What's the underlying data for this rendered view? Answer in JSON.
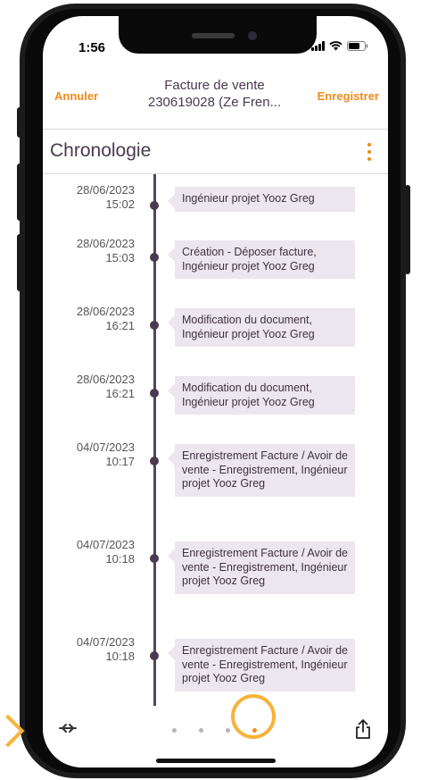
{
  "status_bar": {
    "time": "1:56"
  },
  "nav": {
    "cancel_label": "Annuler",
    "title_line1": "Facture de vente",
    "title_line2": "230619028 (Ze Fren...",
    "save_label": "Enregistrer"
  },
  "section": {
    "title": "Chronologie"
  },
  "events": [
    {
      "date": "28/06/2023",
      "time": "15:02",
      "text": "Ingénieur projet Yooz Greg"
    },
    {
      "date": "28/06/2023",
      "time": "15:03",
      "text": "Création - Déposer facture, Ingénieur projet Yooz Greg"
    },
    {
      "date": "28/06/2023",
      "time": "16:21",
      "text": "Modification du document, Ingénieur projet Yooz Greg"
    },
    {
      "date": "28/06/2023",
      "time": "16:21",
      "text": "Modification du document, Ingénieur projet Yooz Greg"
    },
    {
      "date": "04/07/2023",
      "time": "10:17",
      "text": "Enregistrement Facture / Avoir de vente - Enregistrement, Ingénieur projet Yooz Greg"
    },
    {
      "date": "04/07/2023",
      "time": "10:18",
      "text": "Enregistrement Facture / Avoir de vente - Enregistrement, Ingénieur projet Yooz Greg"
    },
    {
      "date": "04/07/2023",
      "time": "10:18",
      "text": "Enregistrement Facture / Avoir de vente - Enregistrement, Ingénieur projet Yooz Greg"
    }
  ],
  "pager": {
    "total": 4,
    "active_index": 3
  },
  "colors": {
    "accent": "#f08a1c",
    "timeline": "#4a3a4f",
    "bubble": "#ece6ee",
    "highlight": "#f6b33a"
  },
  "icons": {
    "swap": "swap-arrows-icon",
    "share": "share-icon",
    "menu": "more-vertical-icon"
  }
}
